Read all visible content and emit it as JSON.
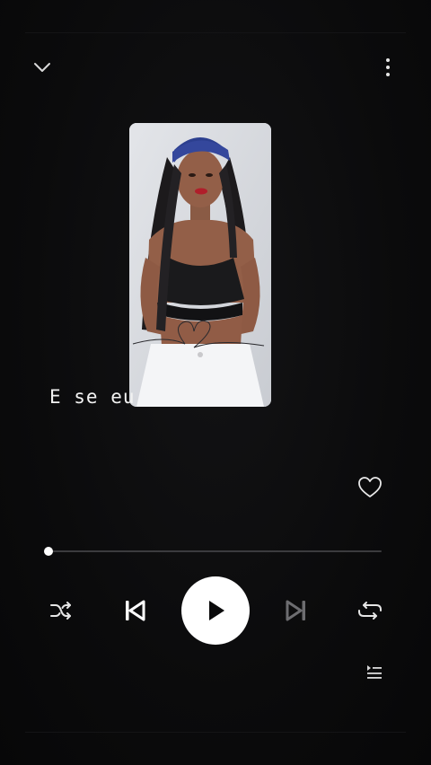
{
  "player": {
    "lyric_line": "E se eu",
    "progress": 0.0,
    "liked": false,
    "is_playing": false
  },
  "icons": {
    "collapse": "chevron-down-icon",
    "more": "more-vertical-icon",
    "like": "heart-outline-icon",
    "shuffle": "shuffle-icon",
    "previous": "skip-previous-icon",
    "play": "play-icon",
    "next": "skip-next-icon",
    "repeat": "repeat-icon",
    "queue": "queue-icon"
  },
  "colors": {
    "background": "#0a0a0b",
    "foreground": "#ffffff",
    "track": "#3b3b3e",
    "disabled": "#6d6d70"
  }
}
